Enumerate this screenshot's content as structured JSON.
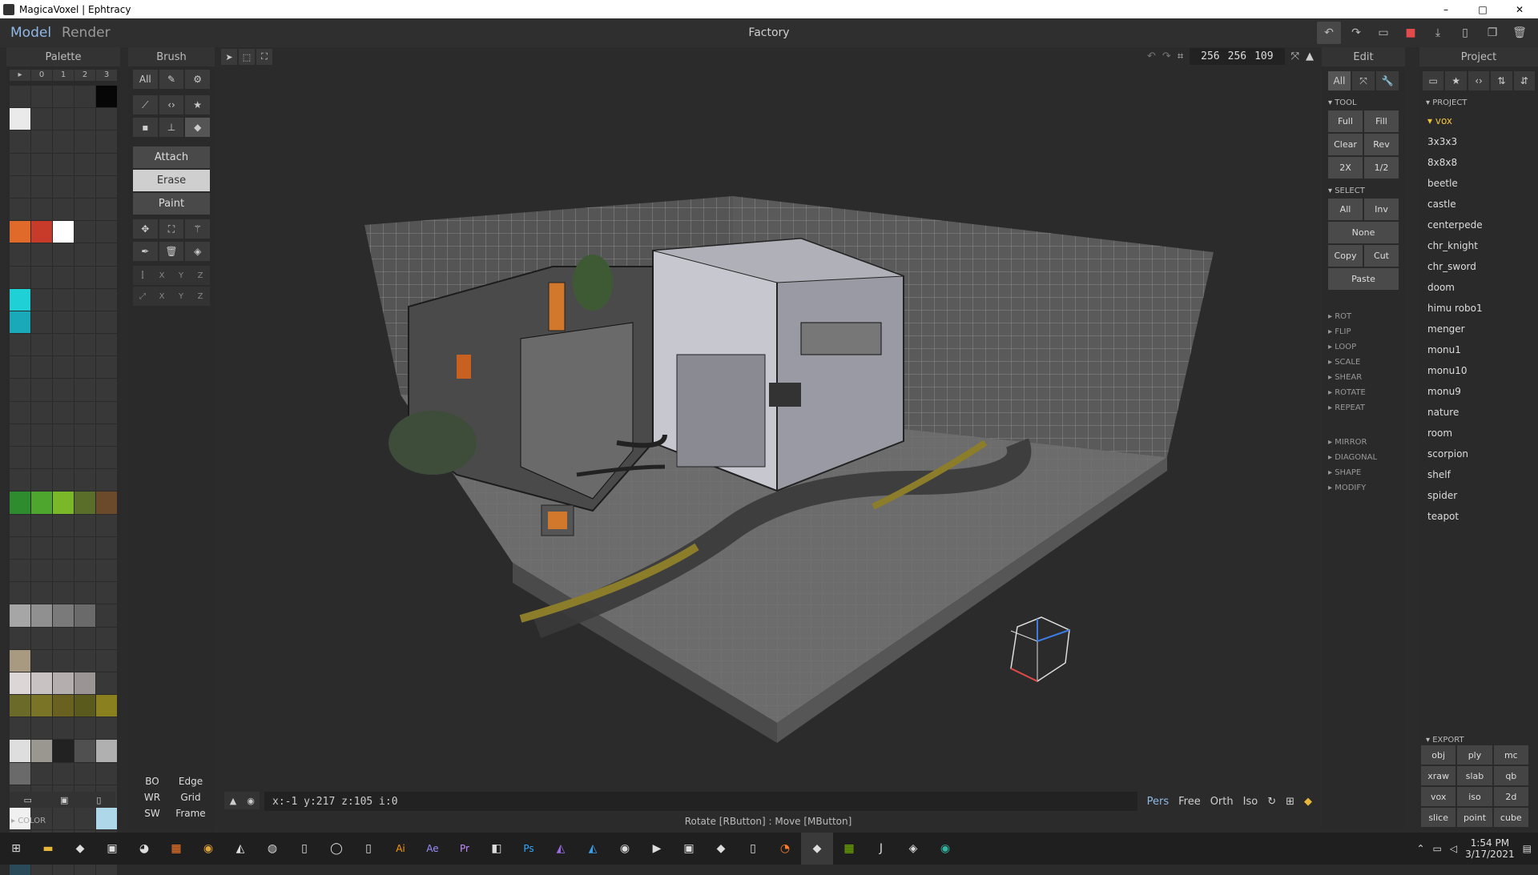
{
  "window": {
    "title": "MagicaVoxel | Ephtracy",
    "controls": [
      "–",
      "□",
      "✕"
    ]
  },
  "menu": {
    "model": "Model",
    "render": "Render",
    "doc_title": "Factory"
  },
  "palette": {
    "header": "Palette",
    "tabs": [
      "▸",
      "0",
      "1",
      "2",
      "3"
    ],
    "footer_color": "▸ COLOR"
  },
  "brush": {
    "header": "Brush",
    "all": "All",
    "modes": [
      "Attach",
      "Erase",
      "Paint"
    ],
    "axis_labels": [
      "X",
      "Y",
      "Z"
    ],
    "render_toggles": [
      "BO",
      "Edge",
      "WR",
      "Grid",
      "SW",
      "Frame"
    ]
  },
  "viewport": {
    "dims": [
      "256",
      "256",
      "109"
    ],
    "coords": "x:-1  y:217 z:105 i:0",
    "view_modes": [
      "Pers",
      "Free",
      "Orth",
      "Iso"
    ],
    "status": "Rotate [RButton] : Move [MButton]"
  },
  "edit": {
    "header": "Edit",
    "all": "All",
    "tool_section": "▾ TOOL",
    "tool_buttons": [
      "Full",
      "Fill",
      "Clear",
      "Rev",
      "2X",
      "1/2"
    ],
    "select_section": "▾ SELECT",
    "select_buttons": [
      "All",
      "Inv"
    ],
    "none": "None",
    "copy": "Copy",
    "cut": "Cut",
    "paste": "Paste",
    "closed_sections": [
      "▸ ROT",
      "▸ FLIP",
      "▸ LOOP",
      "▸ SCALE",
      "▸ SHEAR",
      "▸ ROTATE",
      "▸ REPEAT",
      "▸ MIRROR",
      "▸ DIAGONAL",
      "▸ SHAPE",
      "▸ MODIFY"
    ]
  },
  "project": {
    "header": "Project",
    "section": "▾ PROJECT",
    "folder": "▾ vox",
    "items": [
      "3x3x3",
      "8x8x8",
      "beetle",
      "castle",
      "centerpede",
      "chr_knight",
      "chr_sword",
      "doom",
      "himu robo1",
      "menger",
      "monu1",
      "monu10",
      "monu9",
      "nature",
      "room",
      "scorpion",
      "shelf",
      "spider",
      "teapot"
    ],
    "export_section": "▾ EXPORT",
    "export": [
      "obj",
      "ply",
      "mc",
      "xraw",
      "slab",
      "qb",
      "vox",
      "iso",
      "2d",
      "slice",
      "point",
      "cube"
    ]
  },
  "taskbar": {
    "time": "1:54 PM",
    "date": "3/17/2021"
  },
  "colors": {
    "accent": "#8fb8e6",
    "folder": "#f0c040",
    "save": "#e24b4b"
  }
}
